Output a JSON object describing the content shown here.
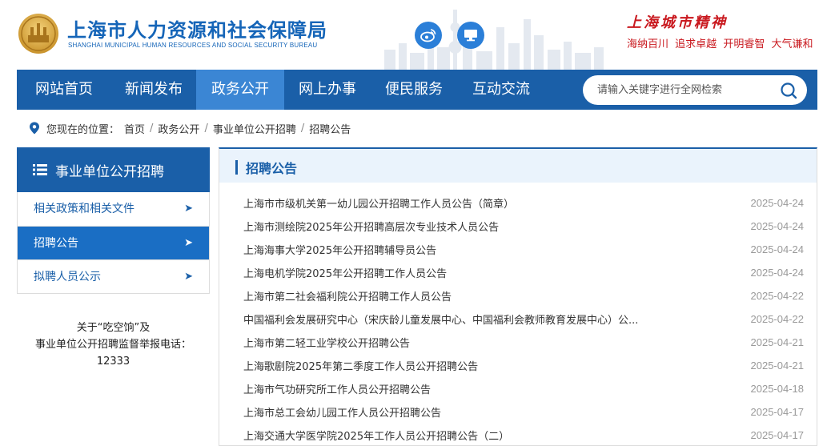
{
  "header": {
    "site_title": "上海市人力资源和社会保障局",
    "site_subtitle": "SHANGHAI MUNICIPAL HUMAN RESOURCES AND SOCIAL SECURITY BUREAU",
    "spirit_title": "上海城市精神",
    "spirit_phrases": [
      "海纳百川",
      "追求卓越",
      "开明睿智",
      "大气谦和"
    ],
    "icons": {
      "weibo": "weibo-icon",
      "screen": "monitor-icon"
    },
    "colors": {
      "brand": "#1565b8",
      "accent_red": "#c9191f"
    }
  },
  "nav": {
    "items": [
      "网站首页",
      "新闻发布",
      "政务公开",
      "网上办事",
      "便民服务",
      "互动交流"
    ],
    "active_index": 2,
    "search_placeholder": "请输入关键字进行全网检索"
  },
  "breadcrumb": {
    "prefix": "您现在的位置：",
    "items": [
      "首页",
      "政务公开",
      "事业单位公开招聘",
      "招聘公告"
    ]
  },
  "sidebar": {
    "title": "事业单位公开招聘",
    "items": [
      {
        "label": "相关政策和相关文件",
        "active": false
      },
      {
        "label": "招聘公告",
        "active": true
      },
      {
        "label": "拟聘人员公示",
        "active": false
      }
    ],
    "note_line1": "关于“吃空饷”及",
    "note_line2": "事业单位公开招聘监督举报电话：",
    "note_phone": "12333"
  },
  "main": {
    "title": "招聘公告",
    "news": [
      {
        "title": "上海市市级机关第一幼儿园公开招聘工作人员公告（简章）",
        "date": "2025-04-24"
      },
      {
        "title": "上海市测绘院2025年公开招聘高层次专业技术人员公告",
        "date": "2025-04-24"
      },
      {
        "title": "上海海事大学2025年公开招聘辅导员公告",
        "date": "2025-04-24"
      },
      {
        "title": "上海电机学院2025年公开招聘工作人员公告",
        "date": "2025-04-24"
      },
      {
        "title": "上海市第二社会福利院公开招聘工作人员公告",
        "date": "2025-04-22"
      },
      {
        "title": "中国福利会发展研究中心（宋庆龄儿童发展中心、中国福利会教师教育发展中心）公...",
        "date": "2025-04-22"
      },
      {
        "title": "上海市第二轻工业学校公开招聘公告",
        "date": "2025-04-21"
      },
      {
        "title": "上海歌剧院2025年第二季度工作人员公开招聘公告",
        "date": "2025-04-21"
      },
      {
        "title": "上海市气功研究所工作人员公开招聘公告",
        "date": "2025-04-18"
      },
      {
        "title": "上海市总工会幼儿园工作人员公开招聘公告",
        "date": "2025-04-17"
      },
      {
        "title": "上海交通大学医学院2025年工作人员公开招聘公告（二）",
        "date": "2025-04-17"
      }
    ]
  }
}
